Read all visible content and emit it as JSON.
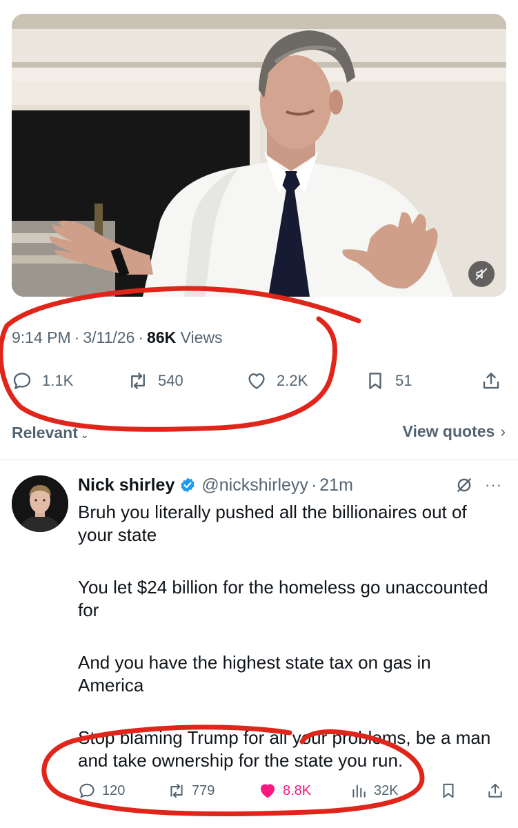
{
  "post": {
    "time": "9:14 PM",
    "date": "3/11/26",
    "views_count": "86K",
    "views_label": "Views",
    "separator": "·",
    "actions": {
      "replies": "1.1K",
      "reposts": "540",
      "likes": "2.2K",
      "bookmarks": "51"
    }
  },
  "sort": {
    "label": "Relevant",
    "chevron": "⌄",
    "view_quotes": "View quotes",
    "view_quotes_chevron": "›"
  },
  "reply": {
    "name": "Nick shirley",
    "handle": "@nickshirleyy",
    "separator": "·",
    "time": "21m",
    "more": "···",
    "paragraphs": [
      "Bruh you literally pushed all the billionaires out of your state",
      "You let $24 billion for the homeless go unaccounted for",
      "And you have the highest state tax on gas in America",
      "Stop blaming Trump for all your problems, be a man and take ownership for the state you run."
    ],
    "actions": {
      "replies": "120",
      "reposts": "779",
      "likes": "8.8K",
      "views": "32K"
    }
  },
  "colors": {
    "text": "#0f1419",
    "muted": "#536471",
    "like": "#f91880",
    "verified": "#1d9bf0",
    "annotation": "#e0261b"
  },
  "icons": {
    "mute": "speaker-muted-icon",
    "reply": "comment-bubble-icon",
    "repost": "repost-arrows-icon",
    "like": "heart-icon",
    "bookmark": "bookmark-icon",
    "share": "share-upload-icon",
    "views": "bar-chart-icon",
    "grok": "grok-slash-icon",
    "verified": "verified-badge-icon"
  }
}
